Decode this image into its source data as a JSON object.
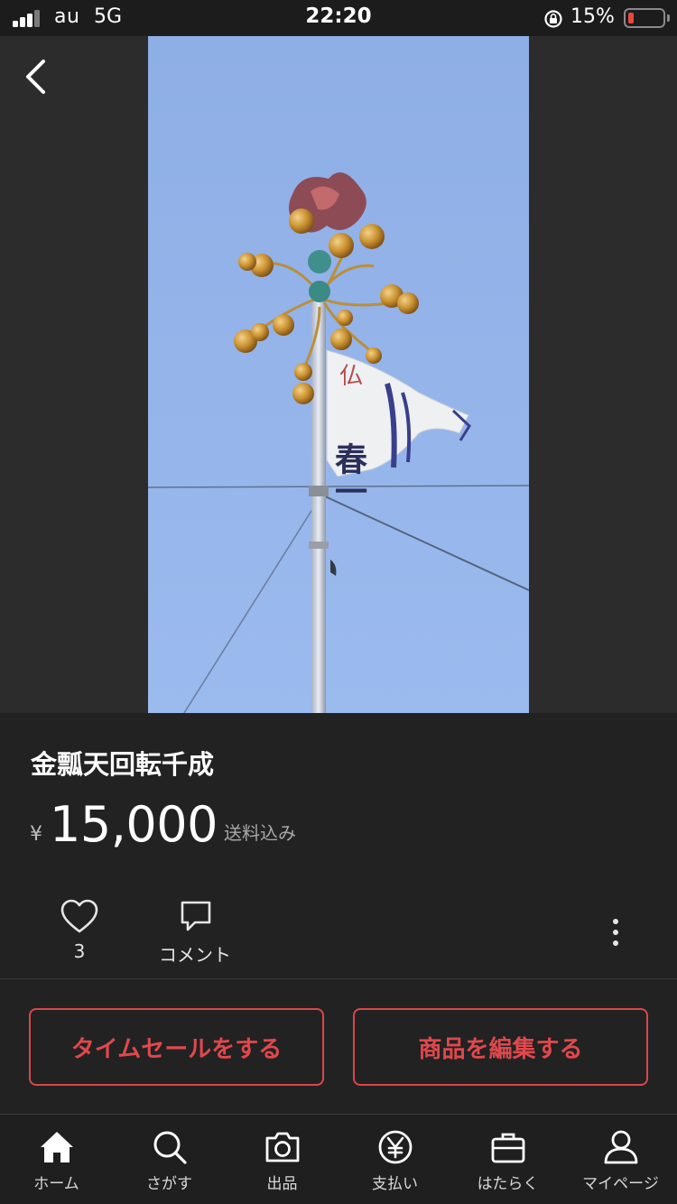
{
  "status_bar": {
    "carrier": "au",
    "network": "5G",
    "time": "22:20",
    "battery": "15%"
  },
  "item": {
    "title": "金瓢天回転千成",
    "currency": "¥",
    "price": "15,000",
    "shipping": "送料込み"
  },
  "actions": {
    "like_count": "3",
    "comment_label": "コメント"
  },
  "buttons": {
    "time_sale": "タイムセールをする",
    "edit_item": "商品を編集する"
  },
  "photo": {
    "flag_text_top": "仏",
    "flag_text_main": "春一"
  },
  "tabs": [
    {
      "label": "ホーム",
      "icon": "home-icon"
    },
    {
      "label": "さがす",
      "icon": "search-icon"
    },
    {
      "label": "出品",
      "icon": "camera-icon"
    },
    {
      "label": "支払い",
      "icon": "yen-icon"
    },
    {
      "label": "はたらく",
      "icon": "briefcase-icon"
    },
    {
      "label": "マイページ",
      "icon": "person-icon"
    }
  ],
  "colors": {
    "background": "#222222",
    "accent": "#e0484c",
    "battery_low": "#e8483c",
    "sky": "#8fb0e8"
  }
}
